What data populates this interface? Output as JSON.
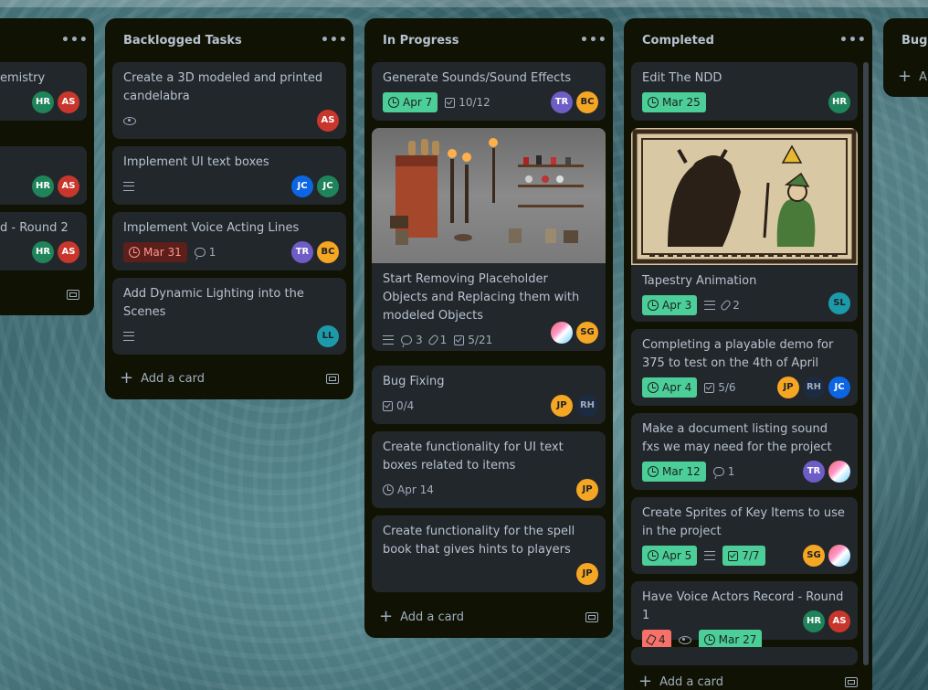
{
  "lists": [
    {
      "title": "",
      "cards": [
        {
          "title": "emistry",
          "avatars": [
            "HR",
            "AS"
          ]
        },
        {
          "title": "",
          "avatars": [
            "HR",
            "AS"
          ]
        },
        {
          "title": "d - Round 2",
          "avatars": [
            "HR",
            "AS"
          ]
        }
      ]
    },
    {
      "title": "Backlogged Tasks",
      "cards": [
        {
          "title": "Create a 3D modeled and printed candelabra",
          "avatars": [
            "AS"
          ]
        },
        {
          "title": "Implement UI text boxes",
          "avatars": [
            "JC",
            "JC"
          ]
        },
        {
          "title": "Implement Voice Acting Lines",
          "date": "Mar 31",
          "comments": "1",
          "avatars": [
            "TR",
            "BC"
          ]
        },
        {
          "title": "Add Dynamic Lighting into the Scenes",
          "avatars": [
            "LL"
          ]
        }
      ],
      "add_card": "Add a card"
    },
    {
      "title": "In Progress",
      "cards": [
        {
          "title": "Generate Sounds/Sound Effects",
          "date": "Apr 7",
          "checklist": "10/12",
          "avatars": [
            "TR",
            "BC"
          ]
        },
        {
          "title": "Start Removing Placeholder Objects and Replacing them with modeled Objects",
          "comments": "3",
          "attachments": "1",
          "checklist": "5/21",
          "avatars": [
            "",
            "SG"
          ]
        },
        {
          "title": "Bug Fixing",
          "checklist": "0/4",
          "avatars": [
            "JP",
            "RH"
          ]
        },
        {
          "title": "Create functionality for UI text boxes related to items",
          "date": "Apr 14",
          "avatars": [
            "JP"
          ]
        },
        {
          "title": "Create functionality for the spell book that gives hints to players",
          "avatars": [
            "JP"
          ]
        }
      ],
      "add_card": "Add a card"
    },
    {
      "title": "Completed",
      "cards": [
        {
          "title": "Edit The NDD",
          "date": "Mar 25",
          "avatars": [
            "HR"
          ]
        },
        {
          "title": "Tapestry Animation",
          "date": "Apr 3",
          "attachments": "2",
          "avatars": [
            "SL"
          ]
        },
        {
          "title": "Completing a playable demo for 375 to test on the 4th of April",
          "date": "Apr 4",
          "checklist": "5/6",
          "avatars": [
            "JP",
            "RH",
            "JC"
          ]
        },
        {
          "title": "Make a document listing sound fxs we may need for the project",
          "date": "Mar 12",
          "comments": "1",
          "avatars": [
            "TR",
            ""
          ]
        },
        {
          "title": "Create Sprites of Key Items to use in the project",
          "date": "Apr 5",
          "checklist": "7/7",
          "avatars": [
            "SG",
            ""
          ]
        },
        {
          "title": "Have Voice Actors Record - Round 1",
          "alert": "4",
          "date": "Mar 27",
          "avatars": [
            "HR",
            "AS"
          ]
        }
      ],
      "add_card": "Add a card"
    },
    {
      "title": "Bugs",
      "add_card": "A"
    }
  ],
  "colors": {
    "list_bg": "#101204",
    "card_bg": "#22272b",
    "date_green": "#4bce97",
    "overdue": "#5d1f1a"
  }
}
